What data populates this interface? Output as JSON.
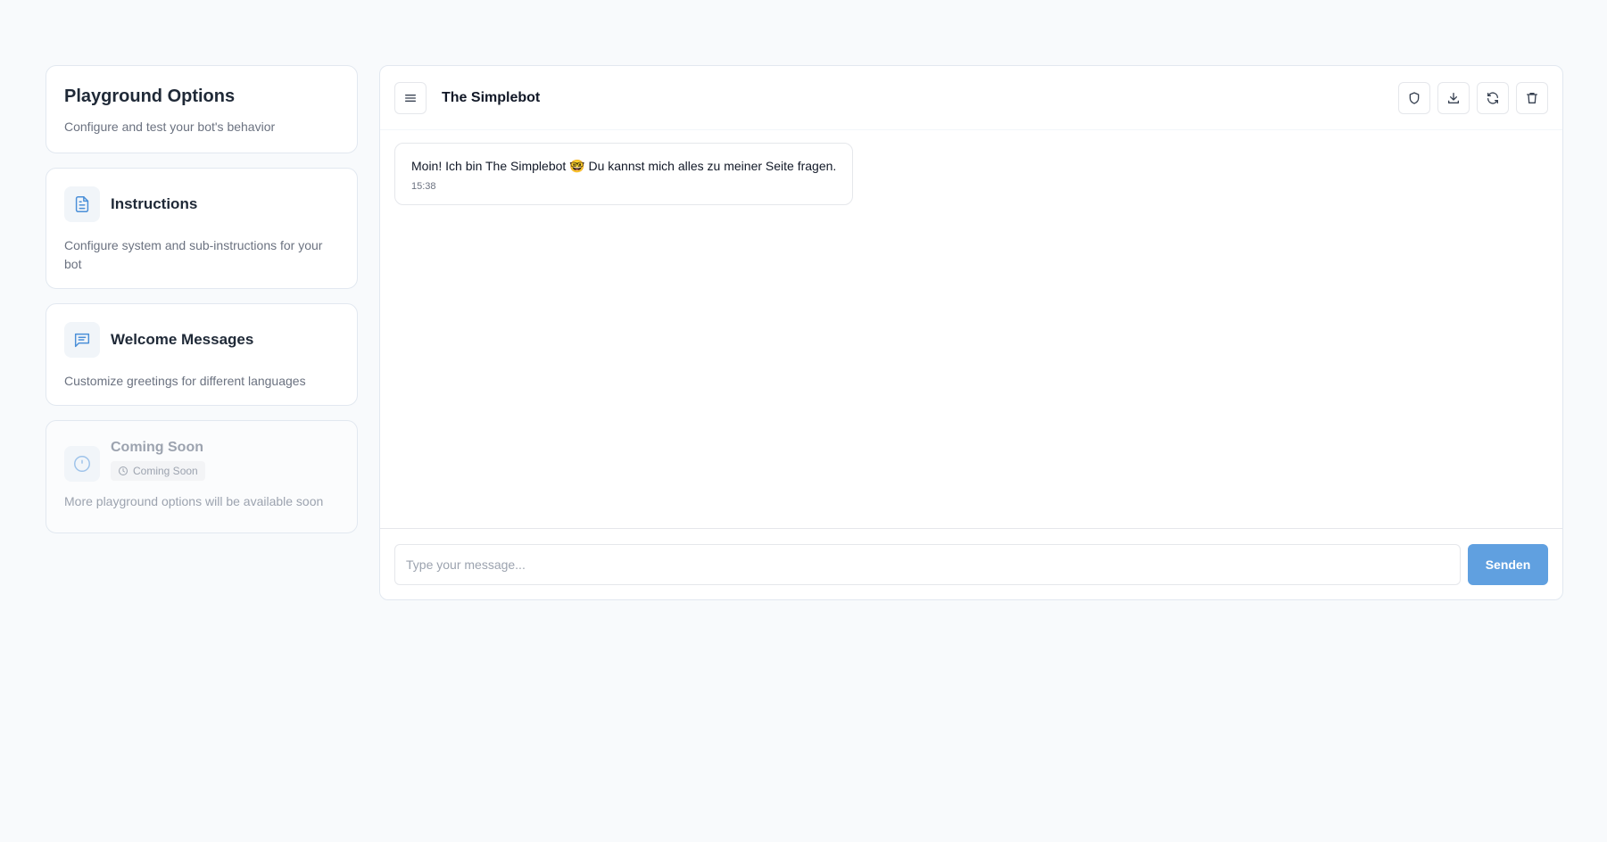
{
  "sidebar": {
    "header": {
      "title": "Playground Options",
      "subtitle": "Configure and test your bot's behavior"
    },
    "options": [
      {
        "title": "Instructions",
        "description": "Configure system and sub-instructions for your bot",
        "icon": "document-icon"
      },
      {
        "title": "Welcome Messages",
        "description": "Customize greetings for different languages",
        "icon": "message-icon"
      },
      {
        "title": "Coming Soon",
        "badge": "Coming Soon",
        "description": "More playground options will be available soon",
        "icon": "clock-icon"
      }
    ]
  },
  "chat": {
    "title": "The Simplebot",
    "messages": [
      {
        "text": "Moin! Ich bin The Simplebot 🤓 Du kannst mich alles zu meiner Seite fragen.",
        "time": "15:38"
      }
    ],
    "input": {
      "placeholder": "Type your message..."
    },
    "send_label": "Senden"
  },
  "colors": {
    "accent": "#60a0e0",
    "icon_blue": "#4a8fd8",
    "background": "#f8fafc"
  }
}
